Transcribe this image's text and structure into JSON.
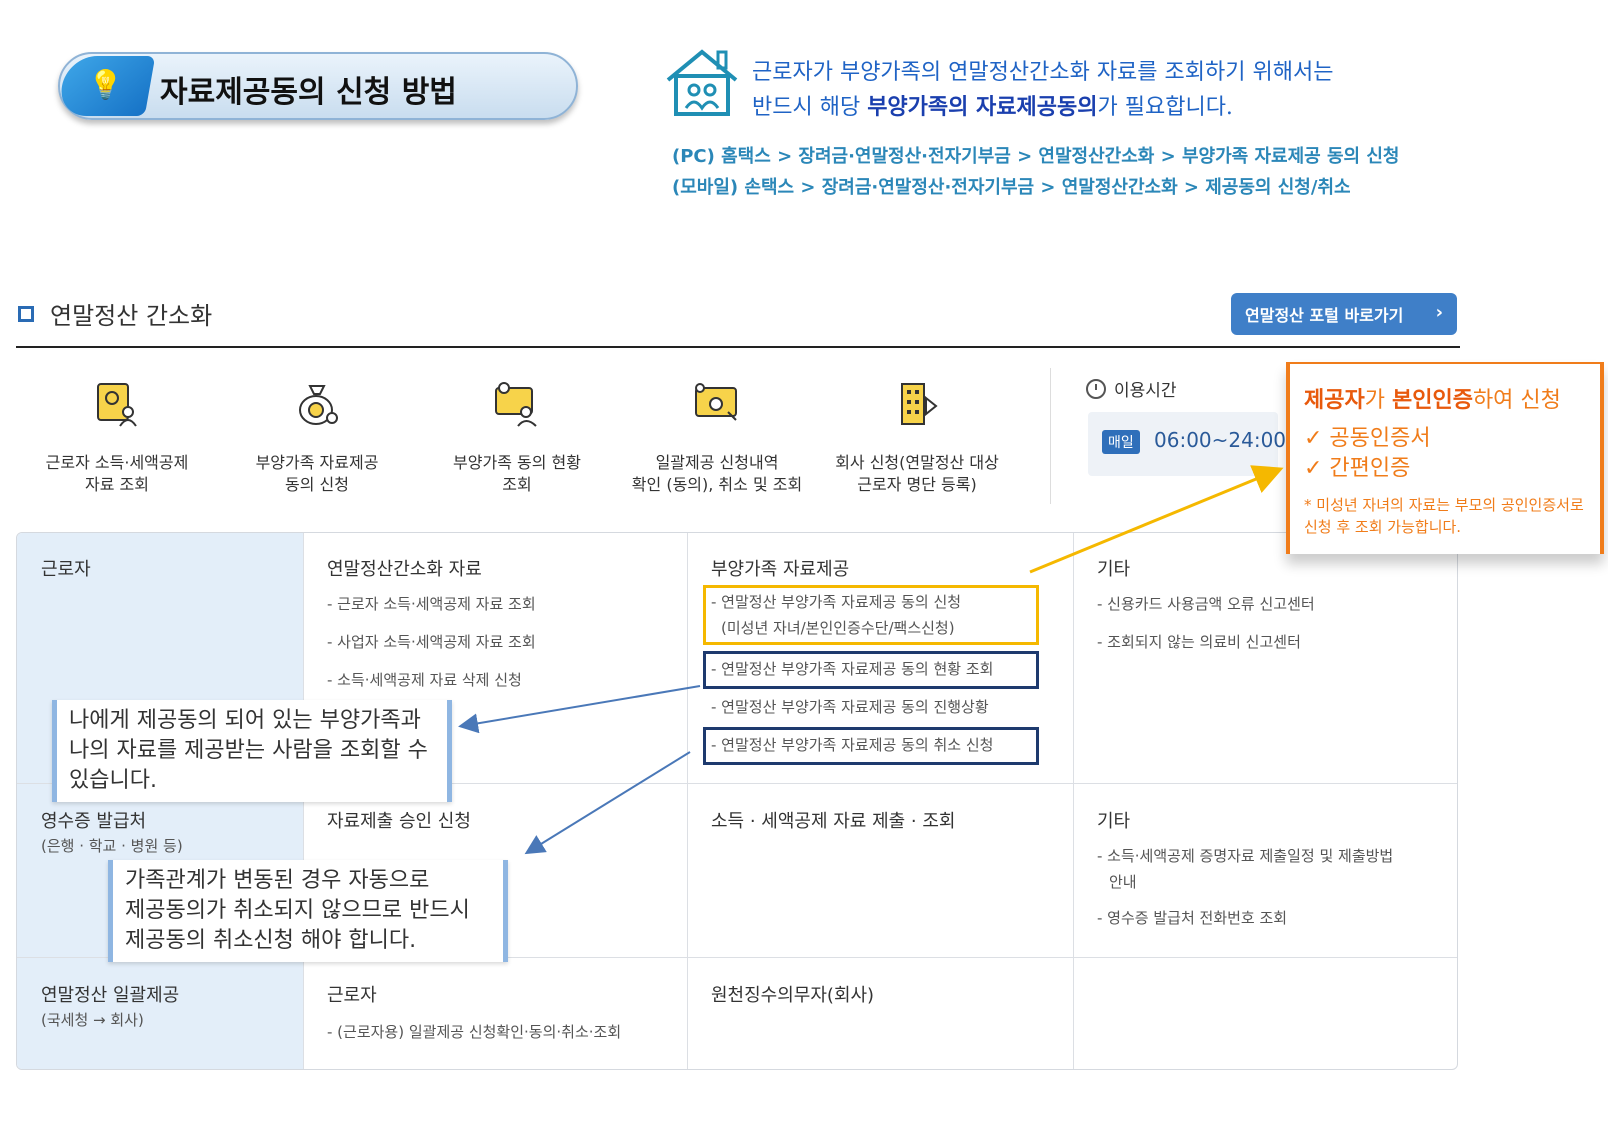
{
  "header": {
    "title": "자료제공동의 신청 방법",
    "notice_line1": "근로자가 부양가족의 연말정산간소화 자료를 조회하기 위해서는",
    "notice_line2_pre": "반드시 해당 ",
    "notice_line2_bold": "부양가족의 자료제공동의",
    "notice_line2_post": "가 필요합니다.",
    "path_pc": "(PC) 홈택스 > 장려금·연말정산·전자기부금 > 연말정산간소화 > 부양가족 자료제공 동의 신청",
    "path_mobile": "(모바일) 손택스 > 장려금·연말정산·전자기부금 > 연말정산간소화 > 제공동의 신청/취소"
  },
  "section": {
    "title": "연말정산 간소화",
    "portal_button": "연말정산 포털 바로가기"
  },
  "menu": [
    {
      "line1": "근로자 소득·세액공제",
      "line2": "자료 조회",
      "icon": "person-document-icon"
    },
    {
      "line1": "부양가족 자료제공",
      "line2": "동의 신청",
      "icon": "money-bag-icon"
    },
    {
      "line1": "부양가족 동의 현황",
      "line2": "조회",
      "icon": "family-status-icon"
    },
    {
      "line1": "일괄제공 신청내역",
      "line2": "확인 (동의), 취소 및 조회",
      "icon": "monitor-check-icon"
    },
    {
      "line1": "회사 신청(연말정산 대상",
      "line2": "근로자 명단 등록)",
      "icon": "building-icon"
    }
  ],
  "hours": {
    "label": "이용시간",
    "badge": "매일",
    "time": "06:00~24:00"
  },
  "orange_callout": {
    "head_bold1": "제공자",
    "head_mid": "가 ",
    "head_bold2": "본인인증",
    "head_post": "하여 신청",
    "item1": "✓ 공동인증서",
    "item2": "✓ 간편인증",
    "note": "* 미성년 자녀의 자료는 부모의 공인인증서로 신청 후 조회 가능합니다."
  },
  "grid": {
    "row1": {
      "label": "근로자",
      "col1_title": "연말정산간소화 자료",
      "col1_items": [
        "- 근로자 소득·세액공제 자료 조회",
        "- 사업자 소득·세액공제 자료 조회",
        "- 소득·세액공제 자료 삭제 신청"
      ],
      "col2_title": "부양가족 자료제공",
      "col2_items": [
        "- 연말정산 부양가족 자료제공 동의 신청",
        "(미성년 자녀/본인인증수단/팩스신청)",
        "- 연말정산 부양가족 자료제공 동의 현황 조회",
        "- 연말정산 부양가족 자료제공 동의 진행상황",
        "- 연말정산 부양가족 자료제공 동의 취소 신청"
      ],
      "col3_title": "기타",
      "col3_items": [
        "- 신용카드 사용금액 오류 신고센터",
        "- 조회되지 않는 의료비 신고센터"
      ]
    },
    "row2": {
      "label": "영수증 발급처",
      "sub": "(은행 · 학교 · 병원 등)",
      "col1_title": "자료제출 승인 신청",
      "col2_title": "소득 · 세액공제 자료 제출 · 조회",
      "col3_title": "기타",
      "col3_items": [
        "- 소득·세액공제 증명자료 제출일정 및 제출방법",
        "안내",
        "- 영수증 발급처 전화번호 조회"
      ]
    },
    "row3": {
      "label": "연말정산 일괄제공",
      "sub": "(국세청 → 회사)",
      "col1_title": "근로자",
      "col1_items": [
        "- (근로자용) 일괄제공 신청확인·동의·취소·조회"
      ],
      "col2_title": "원천징수의무자(회사)"
    }
  },
  "callouts": {
    "c1": [
      "나에게 제공동의 되어 있는 부양가족과",
      "나의 자료를 제공받는 사람을 조회할 수",
      "있습니다."
    ],
    "c2": [
      "가족관계가 변동된 경우 자동으로",
      "제공동의가 취소되지 않으므로 반드시",
      "제공동의 취소신청 해야 합니다."
    ]
  },
  "colors": {
    "accent": "#2a6bb4",
    "orange": "#f07c1a",
    "yellow": "#f5b800",
    "navy": "#1e3a6e"
  }
}
